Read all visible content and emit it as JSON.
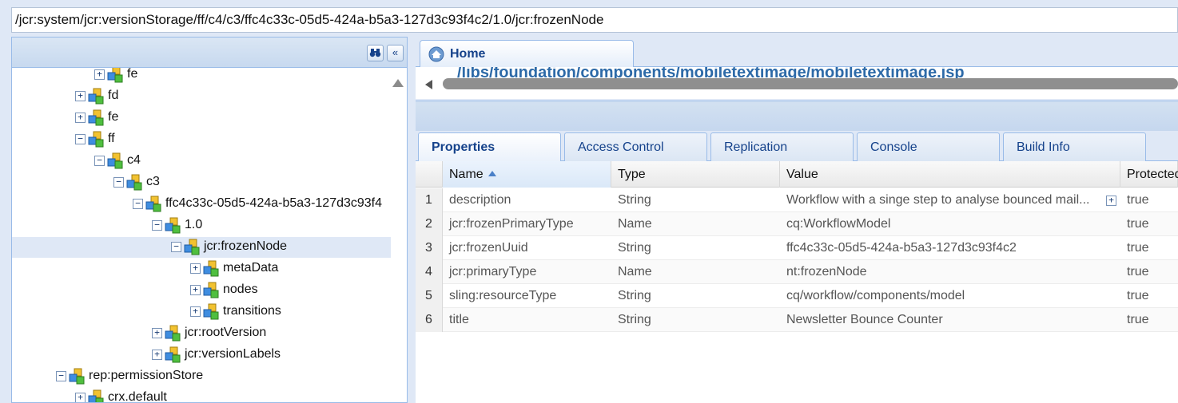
{
  "path_bar": {
    "value": "/jcr:system/jcr:versionStorage/ff/c4/c3/ffc4c33c-05d5-424a-b5a3-127d3c93f4c2/1.0/jcr:frozenNode"
  },
  "tree": {
    "nodes": [
      {
        "label": "fe",
        "expander": "+"
      },
      {
        "label": "fd",
        "expander": "+"
      },
      {
        "label": "fe",
        "expander": "+"
      },
      {
        "label": "ff",
        "expander": "−"
      },
      {
        "label": "c4",
        "expander": "−"
      },
      {
        "label": "c3",
        "expander": "−"
      },
      {
        "label": "ffc4c33c-05d5-424a-b5a3-127d3c93f4",
        "expander": "−"
      },
      {
        "label": "1.0",
        "expander": "−"
      },
      {
        "label": "jcr:frozenNode",
        "expander": "−",
        "selected": true
      },
      {
        "label": "metaData",
        "expander": "+"
      },
      {
        "label": "nodes",
        "expander": "+"
      },
      {
        "label": "transitions",
        "expander": "+"
      },
      {
        "label": "jcr:rootVersion",
        "expander": "+"
      },
      {
        "label": "jcr:versionLabels",
        "expander": "+"
      },
      {
        "label": "rep:permissionStore",
        "expander": "−"
      },
      {
        "label": "crx.default",
        "expander": "+"
      }
    ],
    "header_buttons": {
      "find_icon": "binoculars-icon",
      "collapse_label": "«"
    }
  },
  "editor": {
    "home_tab_label": "Home",
    "cut_off_path": "/libs/foundation/components/mobiletextimage/mobiletextimage.jsp"
  },
  "property_tabs": [
    "Properties",
    "Access Control",
    "Replication",
    "Console",
    "Build Info"
  ],
  "grid": {
    "columns": [
      "Name",
      "Type",
      "Value",
      "Protected"
    ],
    "rows": [
      {
        "num": "1",
        "name": "description",
        "type": "String",
        "value": "Workflow with a singe step to analyse bounced mail...",
        "protected": "true",
        "expandable": true
      },
      {
        "num": "2",
        "name": "jcr:frozenPrimaryType",
        "type": "Name",
        "value": "cq:WorkflowModel",
        "protected": "true"
      },
      {
        "num": "3",
        "name": "jcr:frozenUuid",
        "type": "String",
        "value": "ffc4c33c-05d5-424a-b5a3-127d3c93f4c2",
        "protected": "true"
      },
      {
        "num": "4",
        "name": "jcr:primaryType",
        "type": "Name",
        "value": "nt:frozenNode",
        "protected": "true"
      },
      {
        "num": "5",
        "name": "sling:resourceType",
        "type": "String",
        "value": "cq/workflow/components/model",
        "protected": "true"
      },
      {
        "num": "6",
        "name": "title",
        "type": "String",
        "value": "Newsletter Bounce Counter",
        "protected": "true"
      }
    ]
  },
  "colors": {
    "accent": "#15428b",
    "panel_border": "#99bbe8",
    "selection": "#dfe8f6"
  }
}
